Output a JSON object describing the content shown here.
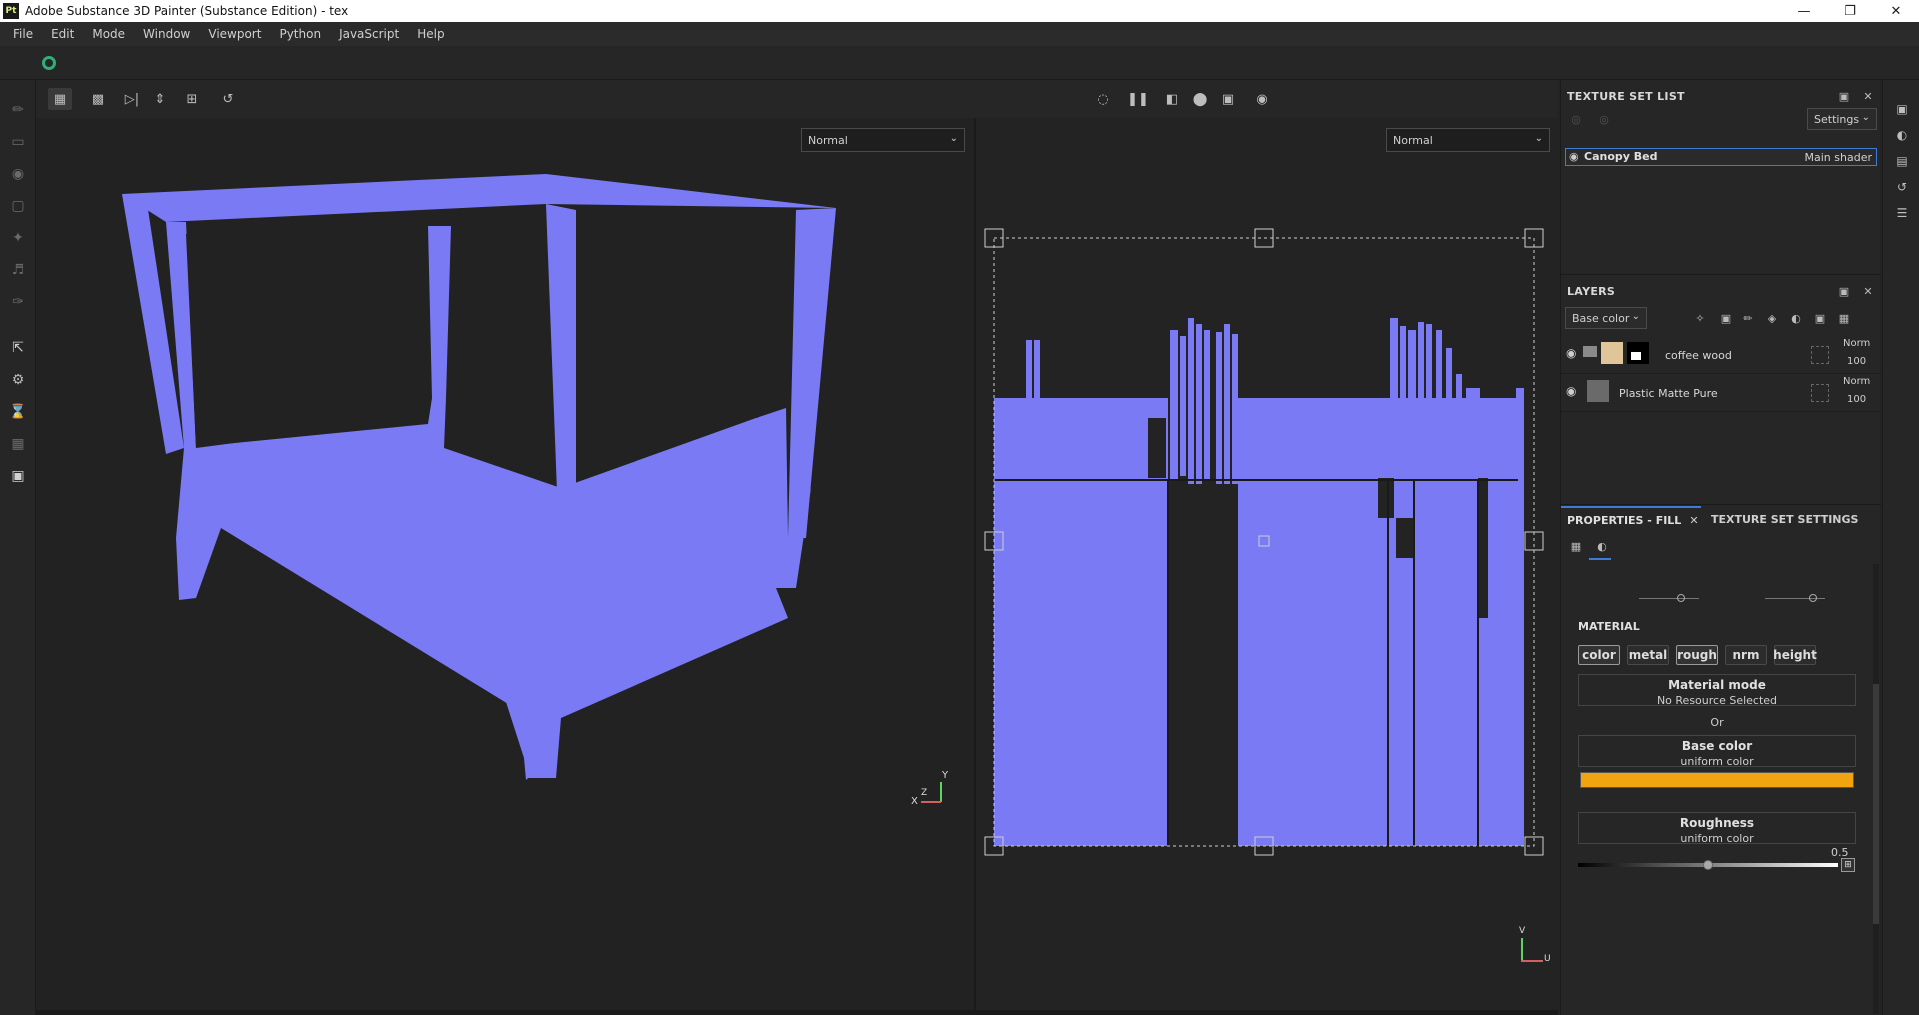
{
  "window": {
    "title": "Adobe Substance 3D Painter (Substance Edition) - tex",
    "logo": "Pt",
    "controls": [
      "minimize-icon",
      "restore-icon",
      "close-icon"
    ]
  },
  "menu": [
    "File",
    "Edit",
    "Mode",
    "Window",
    "Viewport",
    "Python",
    "JavaScript",
    "Help"
  ],
  "viewport3d": {
    "blend_mode": "Normal",
    "gizmo": {
      "x": "X",
      "y": "Y",
      "z": "Z"
    }
  },
  "viewport2d": {
    "blend_mode": "Normal",
    "gizmo": {
      "u": "U",
      "v": "V"
    }
  },
  "texture_set_list": {
    "title": "TEXTURE SET LIST",
    "settings_label": "Settings",
    "items": [
      {
        "name": "Canopy Bed",
        "shader": "Main shader"
      }
    ]
  },
  "layers": {
    "title": "LAYERS",
    "channel": "Base color",
    "items": [
      {
        "name": "coffee wood",
        "blend": "Norm",
        "opacity": "100"
      },
      {
        "name": "Plastic Matte Pure",
        "blend": "Norm",
        "opacity": "100"
      }
    ]
  },
  "properties": {
    "tab_active": "PROPERTIES - FILL",
    "tab_other": "TEXTURE SET SETTINGS",
    "section": "MATERIAL",
    "channels": [
      "color",
      "metal",
      "rough",
      "nrm",
      "height"
    ],
    "material_mode": {
      "title": "Material mode",
      "value": "No Resource Selected"
    },
    "or_label": "Or",
    "base_color": {
      "title": "Base color",
      "value": "uniform color",
      "swatch": "#f2a410"
    },
    "roughness": {
      "title": "Roughness",
      "value": "uniform color",
      "amount": "0.5"
    }
  },
  "colors": {
    "mesh": "#7a7af5",
    "accent": "#3d7bd6"
  }
}
